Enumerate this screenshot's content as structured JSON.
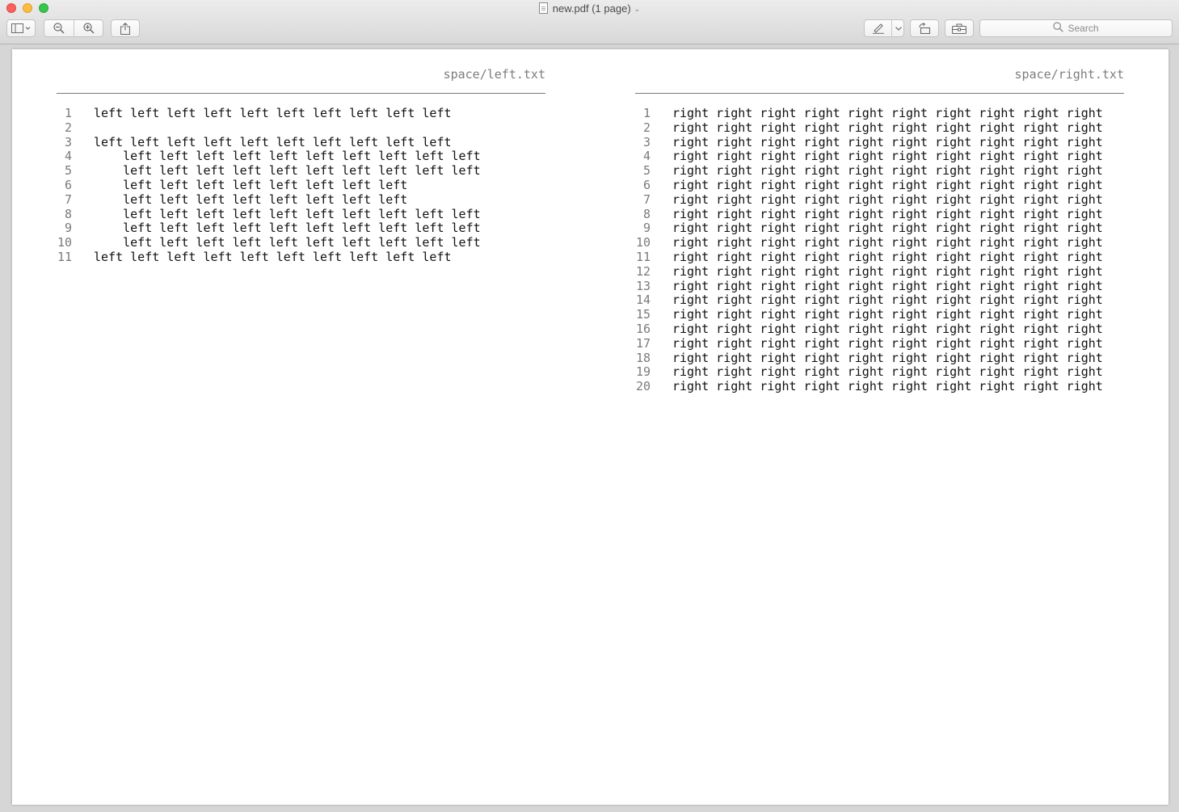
{
  "window": {
    "title": "new.pdf (1 page)"
  },
  "toolbar": {
    "sidebar_icon": "sidebar-icon",
    "zoom_out_icon": "zoom-out-icon",
    "zoom_in_icon": "zoom-in-icon",
    "share_icon": "share-icon",
    "markup_icon": "pen-icon",
    "rotate_icon": "rotate-icon",
    "toolbox_icon": "toolbox-icon"
  },
  "search": {
    "placeholder": "Search"
  },
  "colors": {
    "close": "#fc605c",
    "minimize": "#fdbc40",
    "maximize": "#34c84a",
    "line_number": "#7a7a7a",
    "header_text": "#7d7d7d"
  },
  "left_pane": {
    "filename": "space/left.txt",
    "lines": [
      {
        "n": "1",
        "text": "left left left left left left left left left left"
      },
      {
        "n": "2",
        "text": ""
      },
      {
        "n": "3",
        "text": "left left left left left left left left left left"
      },
      {
        "n": "4",
        "text": "    left left left left left left left left left left"
      },
      {
        "n": "5",
        "text": "    left left left left left left left left left left"
      },
      {
        "n": "6",
        "text": "    left left left left left left left left"
      },
      {
        "n": "7",
        "text": "    left left left left left left left left"
      },
      {
        "n": "8",
        "text": "    left left left left left left left left left left"
      },
      {
        "n": "9",
        "text": "    left left left left left left left left left left"
      },
      {
        "n": "10",
        "text": "    left left left left left left left left left left"
      },
      {
        "n": "11",
        "text": "left left left left left left left left left left"
      }
    ]
  },
  "right_pane": {
    "filename": "space/right.txt",
    "lines": [
      {
        "n": "1",
        "text": "right right right right right right right right right right"
      },
      {
        "n": "2",
        "text": "right right right right right right right right right right"
      },
      {
        "n": "3",
        "text": "right right right right right right right right right right"
      },
      {
        "n": "4",
        "text": "right right right right right right right right right right"
      },
      {
        "n": "5",
        "text": "right right right right right right right right right right"
      },
      {
        "n": "6",
        "text": "right right right right right right right right right right"
      },
      {
        "n": "7",
        "text": "right right right right right right right right right right"
      },
      {
        "n": "8",
        "text": "right right right right right right right right right right"
      },
      {
        "n": "9",
        "text": "right right right right right right right right right right"
      },
      {
        "n": "10",
        "text": "right right right right right right right right right right"
      },
      {
        "n": "11",
        "text": "right right right right right right right right right right"
      },
      {
        "n": "12",
        "text": "right right right right right right right right right right"
      },
      {
        "n": "13",
        "text": "right right right right right right right right right right"
      },
      {
        "n": "14",
        "text": "right right right right right right right right right right"
      },
      {
        "n": "15",
        "text": "right right right right right right right right right right"
      },
      {
        "n": "16",
        "text": "right right right right right right right right right right"
      },
      {
        "n": "17",
        "text": "right right right right right right right right right right"
      },
      {
        "n": "18",
        "text": "right right right right right right right right right right"
      },
      {
        "n": "19",
        "text": "right right right right right right right right right right"
      },
      {
        "n": "20",
        "text": "right right right right right right right right right right"
      }
    ]
  }
}
